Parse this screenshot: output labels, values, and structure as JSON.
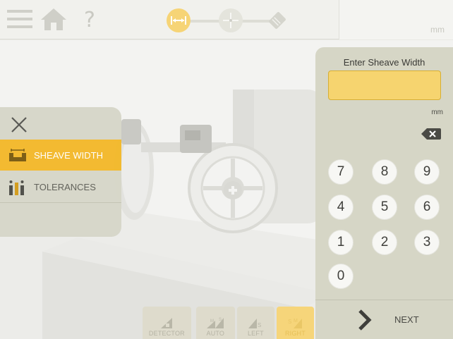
{
  "header": {
    "unit": "mm",
    "icons": [
      "hamburger-menu-icon",
      "home-icon",
      "help-icon"
    ],
    "help_glyph": "?",
    "steps": [
      "sheave-width-step-icon",
      "target-step-icon",
      "measure-step-icon"
    ]
  },
  "left_menu": {
    "items": [
      {
        "label": "SHEAVE WIDTH",
        "icon": "sheave-width-icon",
        "selected": true
      },
      {
        "label": "TOLERANCES",
        "icon": "tolerances-icon",
        "selected": false
      }
    ]
  },
  "keypad": {
    "title": "Enter Sheave Width",
    "value": "",
    "unit": "mm",
    "keys": [
      "7",
      "8",
      "9",
      "4",
      "5",
      "6",
      "1",
      "2",
      "3",
      "0"
    ],
    "next_label": "NEXT"
  },
  "detector_tabs": {
    "items": [
      {
        "label": "DETECTOR"
      },
      {
        "label": "AUTO"
      },
      {
        "label": "LEFT"
      },
      {
        "label": "RIGHT",
        "active": true
      }
    ]
  },
  "colors": {
    "accent": "#f3b92b",
    "input_fill": "#f6d46f",
    "panel": "#d6d6c6",
    "key": "#f7f7f4"
  }
}
